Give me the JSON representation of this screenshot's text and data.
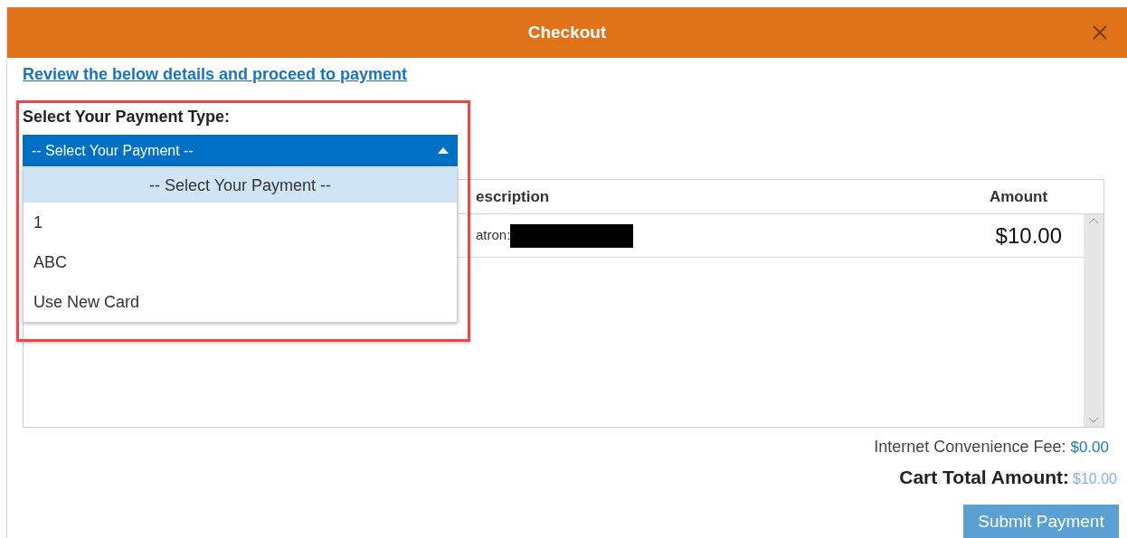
{
  "dialog": {
    "title": "Checkout"
  },
  "intro_link": "Review the below details and proceed to payment",
  "payment": {
    "label": "Select Your Payment Type:",
    "select": {
      "value": "-- Select Your Payment --",
      "expanded": true
    },
    "options": [
      {
        "label": "-- Select Your Payment --",
        "selected": true
      },
      {
        "label": "1",
        "selected": false
      },
      {
        "label": "ABC",
        "selected": false
      },
      {
        "label": "Use New Card",
        "selected": false
      }
    ]
  },
  "table": {
    "columns": [
      "escription",
      "Amount"
    ],
    "rows": [
      {
        "description": "atron:",
        "amount": "$10.00"
      }
    ]
  },
  "fee": {
    "label": "Internet Convenience Fee:",
    "value": "$0.00"
  },
  "total": {
    "label": "Cart Total Amount:",
    "value": "$10.00"
  },
  "submit": "Submit Payment"
}
